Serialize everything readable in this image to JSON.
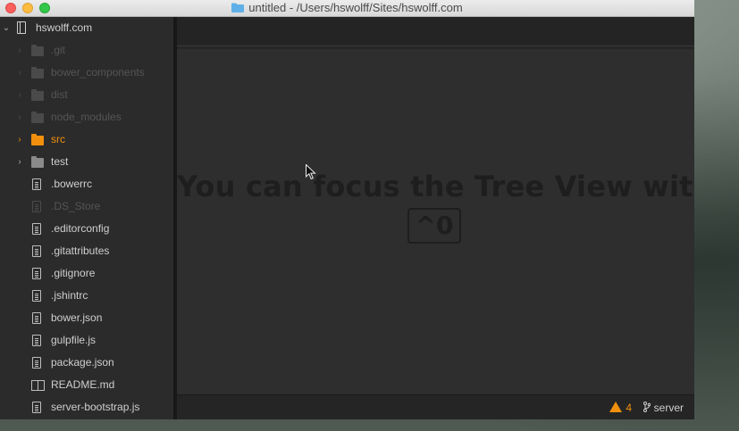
{
  "window": {
    "title": "untitled - /Users/hswolff/Sites/hswolff.com"
  },
  "tree": {
    "root": "hswolff.com",
    "items": [
      {
        "label": ".git",
        "kind": "folder",
        "state": "dim"
      },
      {
        "label": "bower_components",
        "kind": "folder",
        "state": "dim"
      },
      {
        "label": "dist",
        "kind": "folder",
        "state": "dim"
      },
      {
        "label": "node_modules",
        "kind": "folder",
        "state": "dim"
      },
      {
        "label": "src",
        "kind": "folder",
        "state": "active"
      },
      {
        "label": "test",
        "kind": "folder",
        "state": "normal"
      },
      {
        "label": ".bowerrc",
        "kind": "file",
        "state": "normal"
      },
      {
        "label": ".DS_Store",
        "kind": "file",
        "state": "dim"
      },
      {
        "label": ".editorconfig",
        "kind": "file",
        "state": "normal"
      },
      {
        "label": ".gitattributes",
        "kind": "file",
        "state": "normal"
      },
      {
        "label": ".gitignore",
        "kind": "file",
        "state": "normal"
      },
      {
        "label": ".jshintrc",
        "kind": "file",
        "state": "normal"
      },
      {
        "label": "bower.json",
        "kind": "file",
        "state": "normal"
      },
      {
        "label": "gulpfile.js",
        "kind": "file",
        "state": "normal"
      },
      {
        "label": "package.json",
        "kind": "file",
        "state": "normal"
      },
      {
        "label": "README.md",
        "kind": "book",
        "state": "normal"
      },
      {
        "label": "server-bootstrap.js",
        "kind": "file",
        "state": "normal"
      }
    ]
  },
  "editor": {
    "message": "You can focus the Tree View with",
    "shortcut": "^0"
  },
  "status": {
    "warnings": "4",
    "branch": "server"
  },
  "colors": {
    "accent": "#f0900d",
    "sidebar_bg": "#2b2b2b",
    "editor_bg": "#2e2e2e"
  }
}
